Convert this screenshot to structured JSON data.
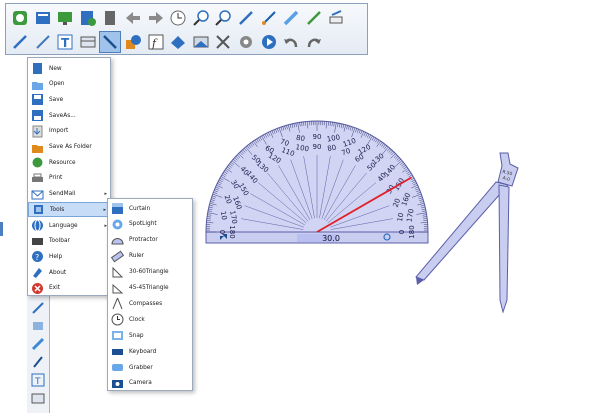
{
  "toolbar": {
    "row1_icons": [
      "select-icon",
      "page-icon",
      "screen-icon",
      "add-page-icon",
      "delete-page-icon",
      "back-arrow-icon",
      "forward-arrow-icon",
      "clock-icon",
      "zoom-in-icon",
      "zoom-out-icon",
      "pen-icon",
      "brush-icon",
      "highlighter-icon",
      "laser-pen-icon",
      "eraser-icon"
    ],
    "row2_icons": [
      "smart-pen-icon",
      "texture-pen-icon",
      "text-icon",
      "clear-icon",
      "line-icon",
      "shape-icon",
      "formula-icon",
      "fill-icon",
      "screenshot-icon",
      "cut-icon",
      "settings-icon",
      "play-icon",
      "undo-icon",
      "redo-icon"
    ],
    "selected_row2_index": 4
  },
  "main_menu": {
    "items": [
      {
        "label": "New",
        "icon": "new-file-icon"
      },
      {
        "label": "Open",
        "icon": "open-folder-icon"
      },
      {
        "label": "Save",
        "icon": "save-icon"
      },
      {
        "label": "SaveAs...",
        "icon": "save-as-icon"
      },
      {
        "label": "Import",
        "icon": "import-icon"
      },
      {
        "label": "Save As Folder",
        "icon": "save-as-folder-icon"
      },
      {
        "label": "Resource",
        "icon": "resource-icon"
      },
      {
        "label": "Print",
        "icon": "print-icon"
      },
      {
        "label": "SendMail",
        "icon": "mail-icon",
        "has_submenu": true
      },
      {
        "label": "Tools",
        "icon": "tools-icon",
        "has_submenu": true,
        "selected": true
      },
      {
        "label": "Language",
        "icon": "language-icon",
        "has_submenu": true
      },
      {
        "label": "Toolbar",
        "icon": "toolbar-icon"
      },
      {
        "label": "Help",
        "icon": "help-icon"
      },
      {
        "label": "About",
        "icon": "about-icon"
      },
      {
        "label": "Exit",
        "icon": "exit-icon"
      }
    ],
    "submenu_arrow": "▸"
  },
  "tools_submenu": {
    "items": [
      {
        "label": "Curtain",
        "icon": "curtain-icon"
      },
      {
        "label": "SpotLight",
        "icon": "spotlight-icon"
      },
      {
        "label": "Protractor",
        "icon": "protractor-icon"
      },
      {
        "label": "Ruler",
        "icon": "ruler-icon"
      },
      {
        "label": "30-60Triangle",
        "icon": "triangle-30-60-icon"
      },
      {
        "label": "45-45Triangle",
        "icon": "triangle-45-45-icon"
      },
      {
        "label": "Compasses",
        "icon": "compasses-icon"
      },
      {
        "label": "Clock",
        "icon": "clock-icon"
      },
      {
        "label": "Snap",
        "icon": "snap-icon"
      },
      {
        "label": "Keyboard",
        "icon": "keyboard-icon"
      },
      {
        "label": "Grabber",
        "icon": "grabber-icon"
      },
      {
        "label": "Camera",
        "icon": "camera-icon"
      }
    ]
  },
  "protractor": {
    "angle_readout": "30.0",
    "outer_labels": [
      "0",
      "10",
      "20",
      "30",
      "40",
      "50",
      "60",
      "70",
      "80",
      "90",
      "100",
      "110",
      "120",
      "130",
      "140",
      "150",
      "160",
      "170",
      "180"
    ],
    "inner_labels": [
      "180",
      "170",
      "160",
      "150",
      "140",
      "130",
      "120",
      "110",
      "100",
      "90",
      "80",
      "70",
      "60",
      "50",
      "40",
      "30",
      "20",
      "10",
      "0"
    ],
    "measured_angle_deg": 30,
    "colors": {
      "fill": "#c9cdf0",
      "stroke": "#5a5fa8",
      "arm": "#e0202a",
      "readout_bar": "#b9bfee"
    }
  },
  "compass": {
    "label_line1": "R.50",
    "label_line2": "A:0",
    "colors": {
      "fill": "#c9cdf0",
      "stroke": "#5a5fa8"
    }
  },
  "colors": {
    "toolbar_bg": "#e6edf6",
    "menu_highlight": "#c7dcf6",
    "icon_blue": "#2f6fc0",
    "icon_green": "#3c9a3c",
    "icon_orange": "#e08a1e"
  }
}
